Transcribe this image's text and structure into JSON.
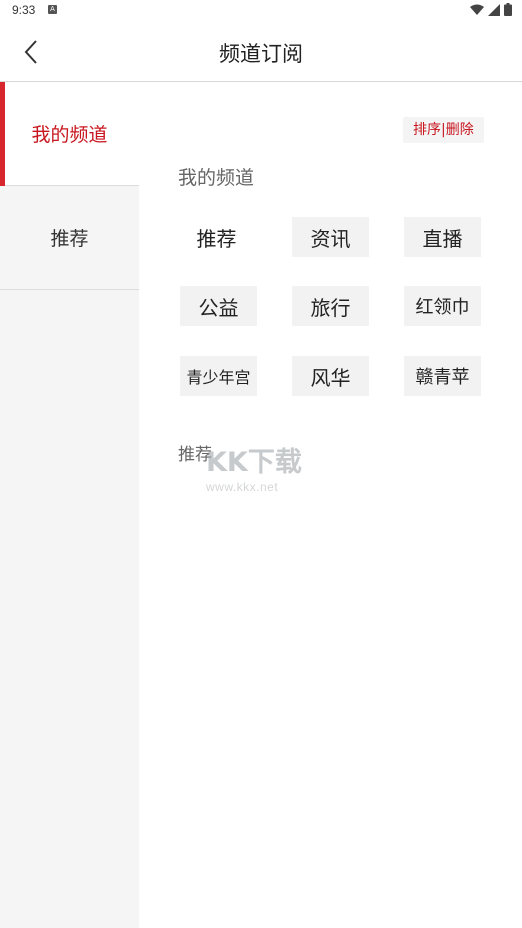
{
  "status_bar": {
    "time": "9:33",
    "notification_letter": "A",
    "icons": [
      "wifi-icon",
      "signal-icon",
      "battery-icon"
    ]
  },
  "header": {
    "title": "频道订阅",
    "back_icon": "chevron-left-icon"
  },
  "sidebar": {
    "items": [
      {
        "label": "我的频道",
        "active": true
      },
      {
        "label": "推荐",
        "active": false
      }
    ]
  },
  "main": {
    "edit_action": "排序|删除",
    "my_channels_title": "我的频道",
    "channels": [
      {
        "label": "推荐"
      },
      {
        "label": "资讯"
      },
      {
        "label": "直播"
      },
      {
        "label": "公益"
      },
      {
        "label": "旅行"
      },
      {
        "label": "红领巾"
      },
      {
        "label": "青少年宫"
      },
      {
        "label": "风华"
      },
      {
        "label": "赣青苹"
      }
    ],
    "recommend_title": "推荐"
  },
  "watermark": {
    "text": "KK下载",
    "url": "www.kkx.net"
  },
  "colors": {
    "accent": "#c8161e",
    "active_bar": "#d7262e",
    "sidebar_bg": "#f5f5f5",
    "chip_bg": "#f2f2f2"
  }
}
